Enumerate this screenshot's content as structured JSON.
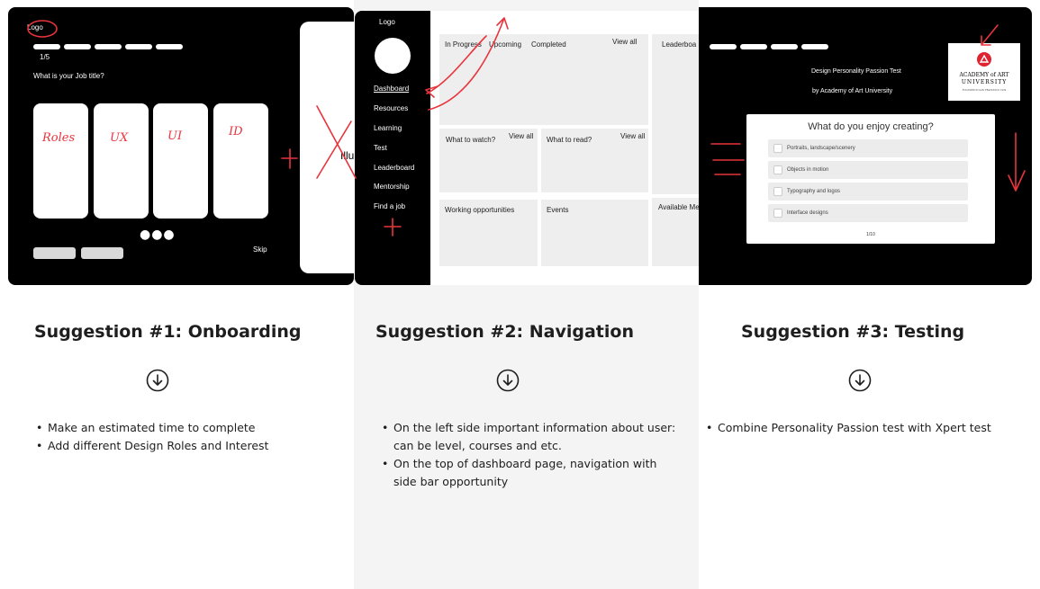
{
  "onboarding_screen": {
    "logo": "Logo",
    "step": "1/5",
    "question": "What is your Job title?",
    "skip": "Skip",
    "side_card_text": "Illu",
    "annotations": [
      "Roles",
      "UX",
      "UI",
      "ID"
    ]
  },
  "navigation_screen": {
    "logo": "Logo",
    "nav_items": [
      "Dashboard",
      "Resources",
      "Learning",
      "Test",
      "Leaderboard",
      "Mentorship",
      "Find a job"
    ],
    "tabs": [
      "In Progress",
      "Upcoming",
      "Completed"
    ],
    "view_all": "View all",
    "leaderboard": "Leaderboa",
    "what_to_watch": "What to watch?",
    "what_to_read": "What to read?",
    "working_opportunities": "Working opportunities",
    "events": "Events",
    "available": "Available Me"
  },
  "testing_screen": {
    "title": "Design Personality Passion Test",
    "subtitle": "by Academy of Art University",
    "logo_line1": "ACADEMY of ART",
    "logo_line2": "UNIVERSITY",
    "logo_line3": "FOUNDED IN SAN FRANCISCO 1929",
    "question": "What do you enjoy creating?",
    "options": [
      "Portraits, landscape/scenery",
      "Objects in motion",
      "Typography and logos",
      "Interface designs"
    ],
    "page": "1/10"
  },
  "suggestions": [
    {
      "heading": "Suggestion #1: Onboarding",
      "bullets": [
        "Make an estimated time to complete",
        "Add different Design Roles and Interest"
      ]
    },
    {
      "heading": "Suggestion #2: Navigation",
      "bullets": [
        "On the left side important information about user: can be level, courses and etc.",
        "On the top of dashboard page, navigation with side bar opportunity"
      ]
    },
    {
      "heading": "Suggestion #3: Testing",
      "bullets": [
        "Combine Personality Passion test with Xpert test"
      ]
    }
  ],
  "colors": {
    "annotation_red": "#e8343c",
    "logo_red": "#e02330",
    "column_bg": "#f4f4f5"
  },
  "icons": [
    "arrow-down-circle-icon",
    "checkbox-icon",
    "academy-logo-icon"
  ]
}
